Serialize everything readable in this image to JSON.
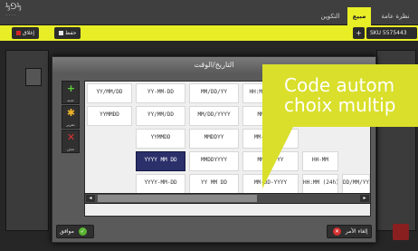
{
  "app": {
    "logo_main": "⅓⅁⅓",
    "logo_sub": "...."
  },
  "tabs": [
    {
      "label": "التكوين"
    },
    {
      "label": "مبيع"
    },
    {
      "label": "نظرة عامة"
    }
  ],
  "toolbar": {
    "close_label": "إغلاق",
    "save_label": "حفظ",
    "add_label": "+",
    "sku_text": "SKU 5575443"
  },
  "dialog": {
    "title": "التاريخ/الوقت",
    "side_buttons": [
      {
        "label": "جديد",
        "icon": "plus-icon"
      },
      {
        "label": "تحرير",
        "icon": "gear-icon"
      },
      {
        "label": "حذف",
        "icon": "close-icon"
      }
    ],
    "formats": [
      [
        {
          "fmt": "YY/MM/DD",
          "sub": ""
        },
        {
          "fmt": "YY-MM-DD",
          "sub": ""
        },
        {
          "fmt": "MM/DD/YY",
          "sub": ""
        },
        {
          "fmt": "HH:MMss (24h)",
          "sub": ""
        }
      ],
      [
        {
          "fmt": "YYMMDD",
          "sub": ""
        },
        {
          "fmt": "YY/MM/DD",
          "sub": ""
        },
        {
          "fmt": "MM/DD/YYYY",
          "sub": ""
        },
        {
          "fmt": "MM DD YY",
          "sub": ""
        }
      ],
      [
        {
          "fmt": "",
          "sub": ""
        },
        {
          "fmt": "YYMMDD",
          "sub": ""
        },
        {
          "fmt": "MMDDYY",
          "sub": ""
        },
        {
          "fmt": "MM-DD-YYYY",
          "sub": ""
        }
      ],
      [
        {
          "fmt": "",
          "sub": ""
        },
        {
          "fmt": "YYYY MM DD",
          "sub": ""
        },
        {
          "fmt": "MMDDYYYY",
          "sub": ""
        },
        {
          "fmt": "MM-DD-YY",
          "sub": ""
        },
        {
          "fmt": "HH-MM",
          "sub": ""
        }
      ],
      [
        {
          "fmt": "",
          "sub": ""
        },
        {
          "fmt": "YYYY-MM-DD",
          "sub": ""
        },
        {
          "fmt": "YY MM DD",
          "sub": ""
        },
        {
          "fmt": "MM-DD-YYYY",
          "sub": ""
        },
        {
          "fmt": "HH:MM (24h)",
          "sub": ""
        },
        {
          "fmt": "DD/MM/YY",
          "sub": ""
        }
      ]
    ],
    "selected": "YYYY MM DD",
    "scroll_left": "◂",
    "scroll_right": "▸",
    "cancel_label": "إلغاء الأمر",
    "ok_label": "موافق"
  },
  "callout": {
    "text": "Code autom\nchoix multip"
  },
  "colors": {
    "accent": "#e8ee26",
    "selected_cell": "#2b2f6a",
    "callout": "#d9df2b"
  }
}
